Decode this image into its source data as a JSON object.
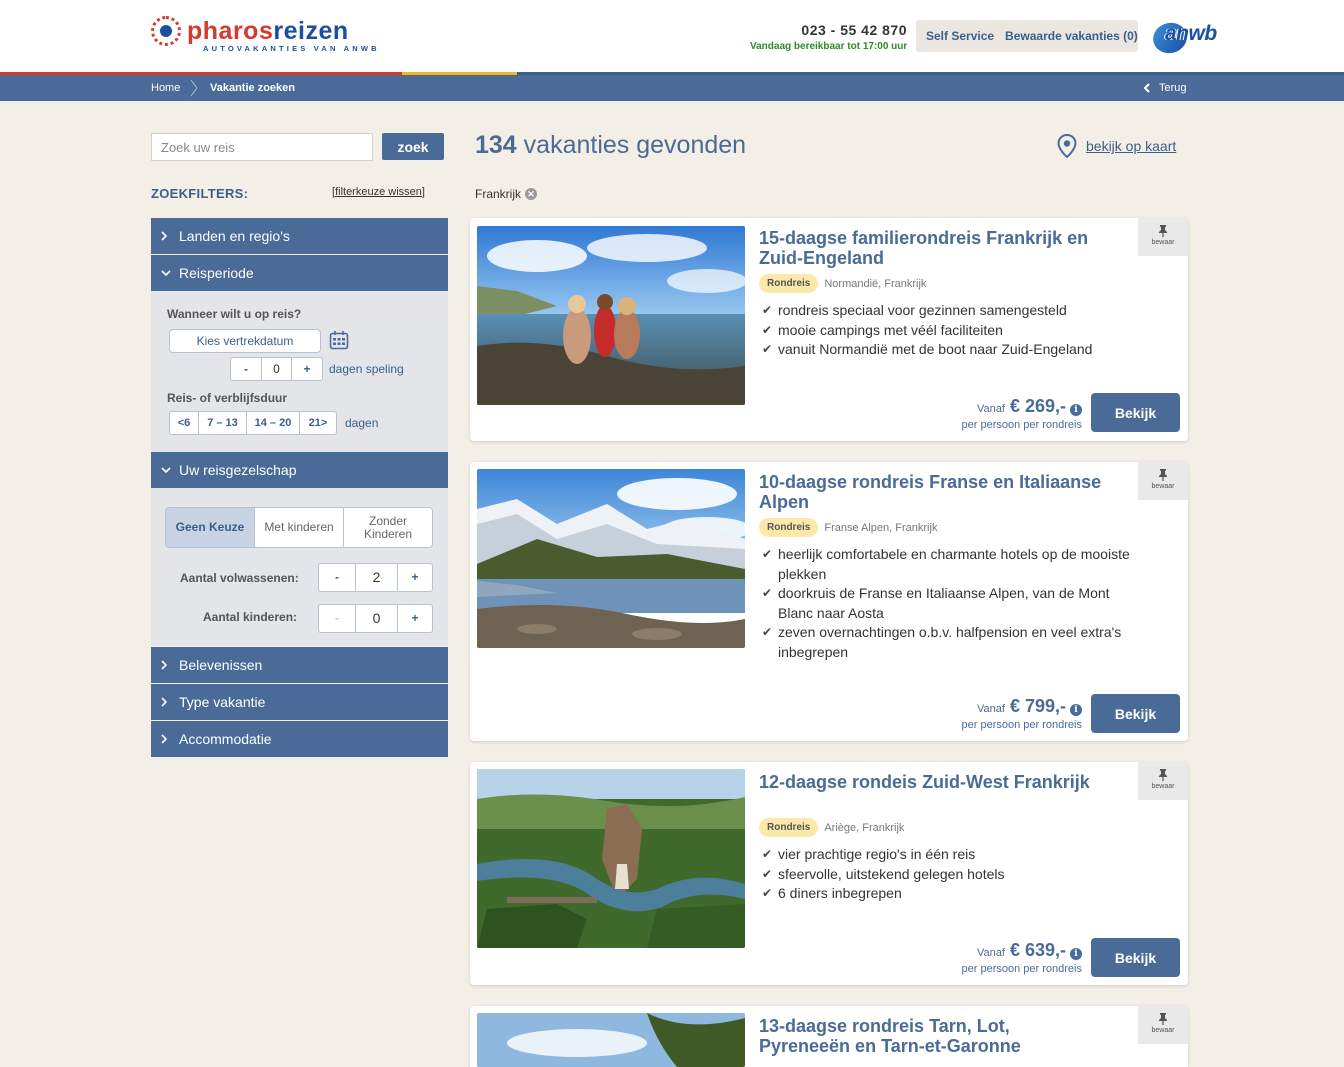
{
  "brand": {
    "name_part1": "pharos",
    "name_part2": "reizen",
    "tagline": "AUTOVAKANTIES VAN ANWB",
    "partner_logo": "anwb"
  },
  "contact": {
    "phone": "023 - 55 42 870",
    "hours": "Vandaag bereikbaar tot 17:00 uur"
  },
  "service_nav": {
    "self_service": "Self Service",
    "saved": "Bewaarde vakanties (0)"
  },
  "breadcrumb": {
    "home": "Home",
    "current": "Vakantie zoeken",
    "back": "Terug"
  },
  "sidebar": {
    "search_placeholder": "Zoek uw reis",
    "search_button": "zoek",
    "filters_title": "ZOEKFILTERS:",
    "clear_bracket_open": "[",
    "clear_label": "filterkeuze  wissen",
    "clear_bracket_close": "]",
    "sections": {
      "landen": "Landen en regio's",
      "reisperiode": "Reisperiode",
      "reisgezelschap": "Uw reisgezelschap",
      "belevenissen": "Belevenissen",
      "type": "Type vakantie",
      "accommodatie": "Accommodatie"
    },
    "period": {
      "question": "Wanneer wilt u op reis?",
      "date_button": "Kies vertrekdatum",
      "minus": "-",
      "speling_value": "0",
      "plus": "+",
      "speling_label": "dagen speling",
      "duration_label": "Reis- of verblijfsduur",
      "durations": [
        "<6",
        "7 – 13",
        "14 – 20",
        "21>"
      ],
      "duration_unit": "dagen"
    },
    "company": {
      "options": [
        "Geen Keuze",
        "Met kinderen",
        "Zonder Kinderen"
      ],
      "adults_label": "Aantal volwassenen:",
      "adults_value": "2",
      "children_label": "Aantal kinderen:",
      "children_value": "0",
      "minus": "-",
      "plus": "+"
    }
  },
  "results": {
    "count": "134",
    "count_label": "vakanties gevonden",
    "map_link": "bekijk op kaart",
    "active_filter": "Frankrijk",
    "save_label": "bewaar",
    "from_label": "Vanaf",
    "per_label": "per persoon per rondreis",
    "view_button": "Bekijk",
    "items": [
      {
        "title": "15-daagse familierondreis Frankrijk en Zuid-Engeland",
        "tag": "Rondreis",
        "location": "Normandië, Frankrijk",
        "features": [
          "rondreis speciaal voor gezinnen samengesteld",
          "mooie campings met véél faciliteiten",
          "vanuit Normandië met de boot naar Zuid-Engeland"
        ],
        "price": "€ 269,-"
      },
      {
        "title": "10-daagse rondreis Franse en Italiaanse Alpen",
        "tag": "Rondreis",
        "location": "Franse Alpen, Frankrijk",
        "features": [
          "heerlijk comfortabele en charmante hotels op de mooiste plekken",
          "doorkruis de Franse en Italiaanse Alpen, van de Mont Blanc naar Aosta",
          "zeven overnachtingen o.b.v. halfpension en veel extra's inbegrepen"
        ],
        "price": "€ 799,-"
      },
      {
        "title": "12-daagse rondeis Zuid-West Frankrijk",
        "tag": "Rondreis",
        "location": "Ariège, Frankrijk",
        "features": [
          "vier prachtige regio's in één reis",
          "sfeervolle, uitstekend gelegen hotels",
          "6 diners inbegrepen"
        ],
        "price": "€ 639,-"
      },
      {
        "title": "13-daagse rondreis Tarn, Lot, Pyreneeën en Tarn-et-Garonne"
      }
    ]
  },
  "colors": {
    "primary": "#4a6b98",
    "brand_red": "#d63a2f",
    "brand_blue": "#1c4fa0",
    "accent_yellow": "#f2b818",
    "tag_yellow": "#fce8a8",
    "page_bg": "#f3efe7",
    "green_text": "#2e8a2e"
  }
}
